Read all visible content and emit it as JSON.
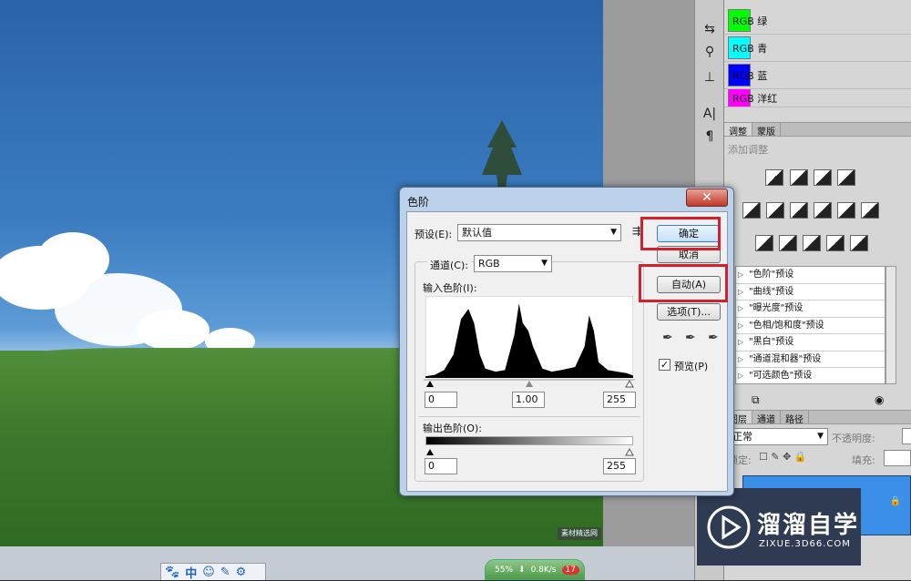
{
  "panels": {
    "swatches": [
      {
        "label": "RGB 绿",
        "color": "#00ff00"
      },
      {
        "label": "RGB 青",
        "color": "#00ffff"
      },
      {
        "label": "RGB 蓝",
        "color": "#0000ff"
      },
      {
        "label": "RGB 洋红",
        "color": "#ff00ff"
      }
    ],
    "adjust_tabs": [
      "调整",
      "蒙版"
    ],
    "adjust_hint": "添加调整",
    "presets": [
      "\"色阶\"预设",
      "\"曲线\"预设",
      "\"曝光度\"预设",
      "\"色相/饱和度\"预设",
      "\"黑白\"预设",
      "\"通道混和器\"预设",
      "\"可选颜色\"预设"
    ],
    "layer_tabs": [
      "图层",
      "通道",
      "路径"
    ],
    "blend_mode": "正常",
    "opacity_label": "不透明度:",
    "lock_label": "锁定:",
    "fill_label": "填充:"
  },
  "dialog": {
    "title": "色阶",
    "preset_label": "预设(E):",
    "preset_value": "默认值",
    "channel_label": "通道(C):",
    "channel_value": "RGB",
    "input_label": "输入色阶(I):",
    "input_values": [
      "0",
      "1.00",
      "255"
    ],
    "output_label": "输出色阶(O):",
    "output_values": [
      "0",
      "255"
    ],
    "ok_label": "确定",
    "cancel_label": "取消",
    "auto_label": "自动(A)",
    "options_label": "选项(T)...",
    "preview_label": "预览(P)",
    "preview_checked": true
  },
  "logo": {
    "title": "溜溜自学",
    "subtitle": "ZIXUE.3D66.COM"
  },
  "taskbar": {
    "ime": "中",
    "net_speed": "0.8K/s",
    "net_percent": "55%",
    "badge": "17"
  },
  "canvas_watermark": "素材精选网",
  "chart_data": {
    "type": "area",
    "title": "",
    "x": [
      0,
      10,
      20,
      30,
      38,
      46,
      52,
      58,
      64,
      75,
      85,
      95,
      100,
      104,
      110,
      115,
      125,
      135,
      145,
      160,
      170,
      175,
      180,
      185,
      195,
      205,
      215,
      222
    ],
    "values": [
      2,
      4,
      10,
      30,
      75,
      88,
      70,
      30,
      12,
      8,
      10,
      55,
      95,
      70,
      60,
      40,
      12,
      8,
      10,
      14,
      40,
      80,
      60,
      20,
      10,
      8,
      6,
      3
    ]
  }
}
